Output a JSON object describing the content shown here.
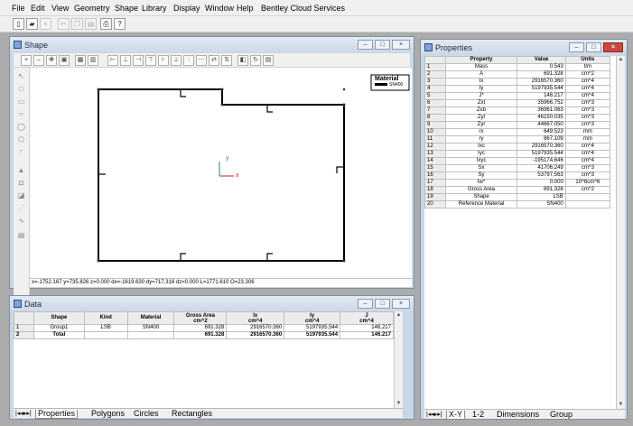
{
  "menu": [
    "File",
    "Edit",
    "View",
    "Geometry",
    "Shape",
    "Library",
    "Display",
    "Window",
    "Help",
    "Bentley Cloud Services"
  ],
  "toolbar_icons": [
    "new-file-icon",
    "open-folder-icon",
    "save-icon",
    "cut-icon",
    "copy-icon",
    "paste-icon",
    "print-icon",
    "help-icon"
  ],
  "shape_window": {
    "title": "Shape",
    "material_box": {
      "title": "Material",
      "item": "SN400"
    },
    "axes": {
      "x": "x",
      "y": "y"
    },
    "status": "x=-1752.167 y=735.826 z=0.000 dx=-1619.630 dy=717.316 dz=0.000 L=1771.610 O=23.306"
  },
  "data_window": {
    "title": "Data",
    "headers": [
      "Shape",
      "Kind",
      "Material",
      "Gross Area\ncm^2",
      "Ix\ncm^4",
      "Iy\ncm^4",
      "J\ncm^4"
    ],
    "rows": [
      {
        "n": "1",
        "cells": [
          "Group1",
          "LSB",
          "SN400",
          "691.328",
          "2916570.360",
          "5197935.544",
          "146.217"
        ]
      },
      {
        "n": "2",
        "cells": [
          "Total",
          "",
          "",
          "691.328",
          "2916570.360",
          "5197935.544",
          "146.217"
        ]
      }
    ],
    "tabs": [
      "Properties",
      "Polygons",
      "Circles",
      "Rectangles"
    ]
  },
  "properties_window": {
    "title": "Properties",
    "headers": [
      "Property",
      "Value",
      "Units"
    ],
    "rows": [
      [
        "1",
        "Mass",
        "0.543",
        "t/m"
      ],
      [
        "2",
        "A",
        "691.328",
        "cm^2"
      ],
      [
        "3",
        "Ix",
        "2916570.360",
        "cm^4"
      ],
      [
        "4",
        "Iy",
        "5197935.544",
        "cm^4"
      ],
      [
        "5",
        "J*",
        "146.217",
        "cm^4"
      ],
      [
        "6",
        "Zxt",
        "35966.752",
        "cm^3"
      ],
      [
        "7",
        "Zxb",
        "36961.063",
        "cm^3"
      ],
      [
        "8",
        "Zyl",
        "46150.035",
        "cm^3"
      ],
      [
        "9",
        "Zyr",
        "44667.050",
        "cm^3"
      ],
      [
        "10",
        "rx",
        "649.523",
        "mm"
      ],
      [
        "11",
        "ry",
        "867.109",
        "mm"
      ],
      [
        "12",
        "Ixc",
        "2916570.360",
        "cm^4"
      ],
      [
        "13",
        "Iyc",
        "5197935.544",
        "cm^4"
      ],
      [
        "14",
        "Ixyc",
        "-195174.646",
        "cm^4"
      ],
      [
        "15",
        "Sx",
        "41706.249",
        "cm^3"
      ],
      [
        "16",
        "Sy",
        "53797.563",
        "cm^3"
      ],
      [
        "17",
        "Iw*",
        "0.000",
        "10^6cm^6"
      ],
      [
        "18",
        "Gross Area",
        "691.328",
        "cm^2"
      ],
      [
        "19",
        "Shape",
        "LSB",
        ""
      ],
      [
        "20",
        "Reference Material",
        "SN400",
        ""
      ]
    ],
    "tabs": [
      "X-Y",
      "1-2",
      "Dimensions",
      "Group"
    ]
  }
}
